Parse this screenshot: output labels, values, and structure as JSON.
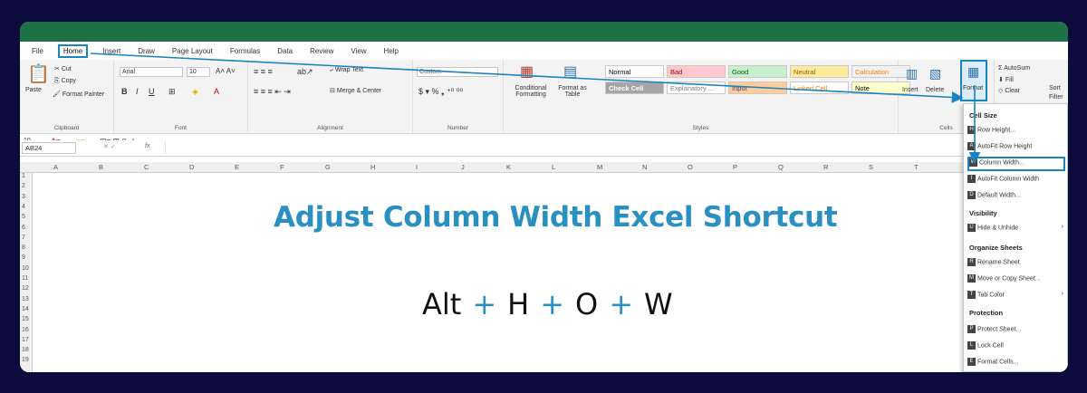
{
  "menu": {
    "items": [
      "File",
      "Home",
      "Insert",
      "Draw",
      "Page Layout",
      "Formulas",
      "Data",
      "Review",
      "View",
      "Help"
    ]
  },
  "clipboard": {
    "paste": "Paste",
    "cut": "Cut",
    "copy": "Copy",
    "format_painter": "Format Painter",
    "label": "Clipboard"
  },
  "font": {
    "name": "Arial",
    "size": "10",
    "label": "Font"
  },
  "alignment": {
    "wrap": "Wrap Text",
    "merge": "Merge & Center",
    "label": "Alignment"
  },
  "number": {
    "format": "Custom",
    "label": "Number"
  },
  "styles": {
    "cond": "Conditional Formatting",
    "table": "Format as Table",
    "cells": [
      {
        "text": "Normal",
        "bg": "#ffffff",
        "fg": "#000000"
      },
      {
        "text": "Bad",
        "bg": "#ffc7ce",
        "fg": "#9c0006"
      },
      {
        "text": "Good",
        "bg": "#c6efce",
        "fg": "#006100"
      },
      {
        "text": "Neutral",
        "bg": "#ffeb9c",
        "fg": "#9c5700"
      },
      {
        "text": "Calculation",
        "bg": "#f2f2f2",
        "fg": "#fa7d00"
      },
      {
        "text": "Check Cell",
        "bg": "#a5a5a5",
        "fg": "#ffffff"
      },
      {
        "text": "Explanatory ...",
        "bg": "#ffffff",
        "fg": "#7f7f7f"
      },
      {
        "text": "Input",
        "bg": "#ffcc99",
        "fg": "#3f3f76"
      },
      {
        "text": "Linked Cell",
        "bg": "#ffffff",
        "fg": "#fa7d00"
      },
      {
        "text": "Note",
        "bg": "#ffffcc",
        "fg": "#000000"
      }
    ],
    "label": "Styles"
  },
  "cells_group": {
    "insert": "Insert",
    "delete": "Delete",
    "format": "Format",
    "label": "Cells"
  },
  "editing": {
    "autosum": "AutoSum",
    "fill": "Fill",
    "clear": "Clear",
    "sort": "Sort",
    "filter": "Filter"
  },
  "qat": {
    "size": "10"
  },
  "namebox": "AB24",
  "fx": "fx",
  "columns": [
    "A",
    "B",
    "C",
    "D",
    "E",
    "F",
    "G",
    "H",
    "I",
    "J",
    "K",
    "L",
    "M",
    "N",
    "O",
    "P",
    "Q",
    "R",
    "S",
    "T"
  ],
  "rows": [
    "1",
    "2",
    "3",
    "4",
    "5",
    "6",
    "7",
    "8",
    "9",
    "10",
    "11",
    "12",
    "13",
    "14",
    "15",
    "16",
    "17",
    "18",
    "19"
  ],
  "title": "Adjust Column Width Excel Shortcut",
  "shortcut": {
    "k1": "Alt",
    "k2": "H",
    "k3": "O",
    "k4": "W",
    "plus": "+"
  },
  "dropdown": {
    "h_cell_size": "Cell Size",
    "row_height": "Row Height...",
    "autofit_row": "AutoFit Row Height",
    "column_width": "Column Width...",
    "autofit_col": "AutoFit Column Width",
    "default_width": "Default Width...",
    "h_visibility": "Visibility",
    "hide_unhide": "Hide & Unhide",
    "h_organize": "Organize Sheets",
    "rename": "Rename Sheet",
    "move_copy": "Move or Copy Sheet...",
    "tab_color": "Tab Color",
    "h_protection": "Protection",
    "protect": "Protect Sheet...",
    "lock": "Lock Cell",
    "format_cells": "Format Cells...",
    "keys": [
      "H",
      "A",
      "W",
      "I",
      "D",
      "U",
      "R",
      "M",
      "T",
      "P",
      "L",
      "E"
    ]
  },
  "colors": {
    "accent": "#2a8fc1",
    "excel_green": "#1e7145",
    "highlight": "#1a84c0"
  }
}
